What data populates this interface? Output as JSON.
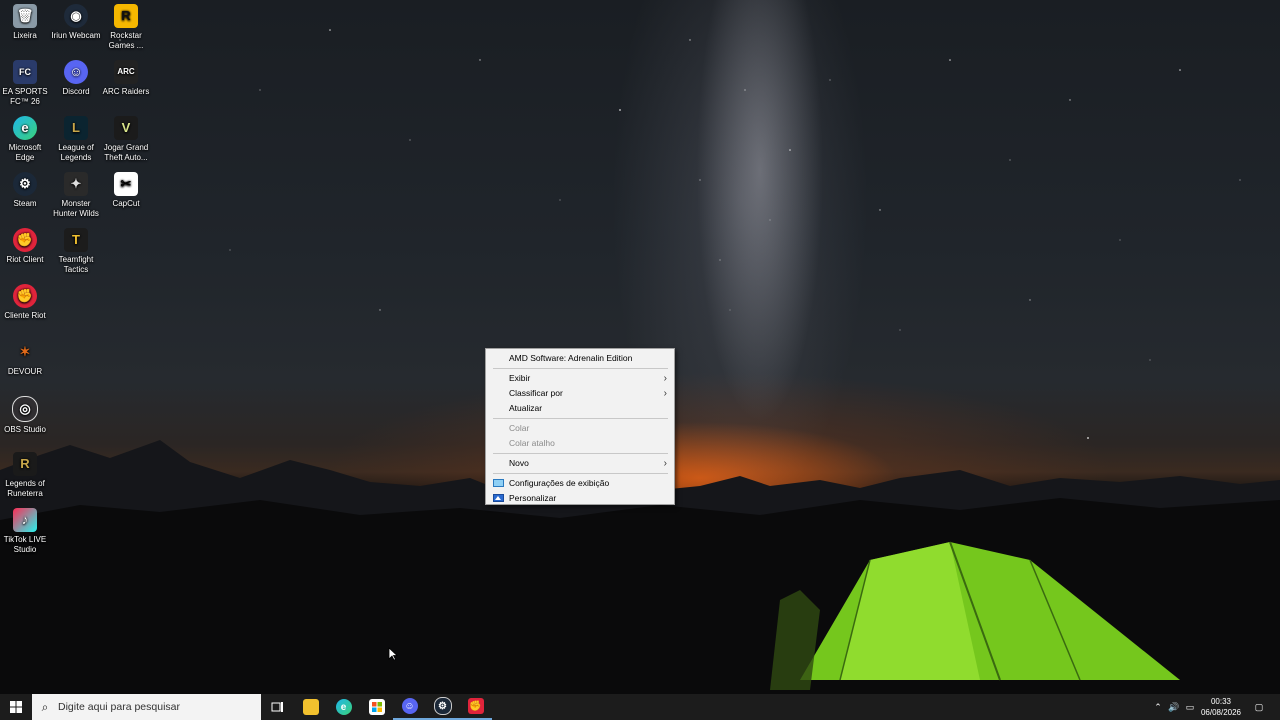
{
  "desktop": {
    "icons": [
      {
        "label": "Lixeira",
        "icon": "recycle-bin-icon"
      },
      {
        "label": "Iriun Webcam",
        "icon": "iriun-webcam-icon"
      },
      {
        "label": "Rockstar Games ...",
        "icon": "rockstar-games-icon"
      },
      {
        "label": "EA SPORTS FC™ 26",
        "icon": "ea-sports-fc-icon"
      },
      {
        "label": "Discord",
        "icon": "discord-icon"
      },
      {
        "label": "ARC Raiders",
        "icon": "arc-raiders-icon"
      },
      {
        "label": "Microsoft Edge",
        "icon": "edge-icon"
      },
      {
        "label": "League of Legends",
        "icon": "league-of-legends-icon"
      },
      {
        "label": "Jogar Grand Theft Auto...",
        "icon": "gta-icon"
      },
      {
        "label": "Steam",
        "icon": "steam-icon"
      },
      {
        "label": "Monster Hunter Wilds",
        "icon": "monster-hunter-icon"
      },
      {
        "label": "CapCut",
        "icon": "capcut-icon"
      },
      {
        "label": "Riot Client",
        "icon": "riot-client-icon"
      },
      {
        "label": "Teamfight Tactics",
        "icon": "teamfight-tactics-icon"
      },
      {
        "label": "Cliente Riot",
        "icon": "cliente-riot-icon"
      },
      {
        "label": "DEVOUR",
        "icon": "devour-icon"
      },
      {
        "label": "OBS Studio",
        "icon": "obs-studio-icon"
      },
      {
        "label": "Legends of Runeterra",
        "icon": "legends-of-runeterra-icon"
      },
      {
        "label": "TikTok LIVE Studio",
        "icon": "tiktok-live-studio-icon"
      }
    ]
  },
  "context_menu": {
    "items": [
      {
        "label": "AMD Software: Adrenalin Edition"
      },
      {
        "label": "Exibir",
        "submenu": true
      },
      {
        "label": "Classificar por",
        "submenu": true
      },
      {
        "label": "Atualizar"
      },
      {
        "label": "Colar",
        "disabled": true
      },
      {
        "label": "Colar atalho",
        "disabled": true
      },
      {
        "label": "Novo",
        "submenu": true
      },
      {
        "label": "Configurações de exibição",
        "icon": "display-settings-icon"
      },
      {
        "label": "Personalizar",
        "icon": "personalize-icon"
      }
    ]
  },
  "taskbar": {
    "search_placeholder": "Digite aqui para pesquisar",
    "apps": [
      "task-view-icon",
      "file-explorer-icon",
      "edge-icon",
      "microsoft-store-icon",
      "discord-icon",
      "steam-icon",
      "riot-client-icon"
    ],
    "clock": {
      "time": "00:33",
      "date": "06/08/2026"
    }
  },
  "colors": {
    "taskbar_bg": "#1c1c1c",
    "menu_bg": "#f2f2f2",
    "search_bg": "#f3f3f3",
    "tent_green": "#7bd21f"
  }
}
